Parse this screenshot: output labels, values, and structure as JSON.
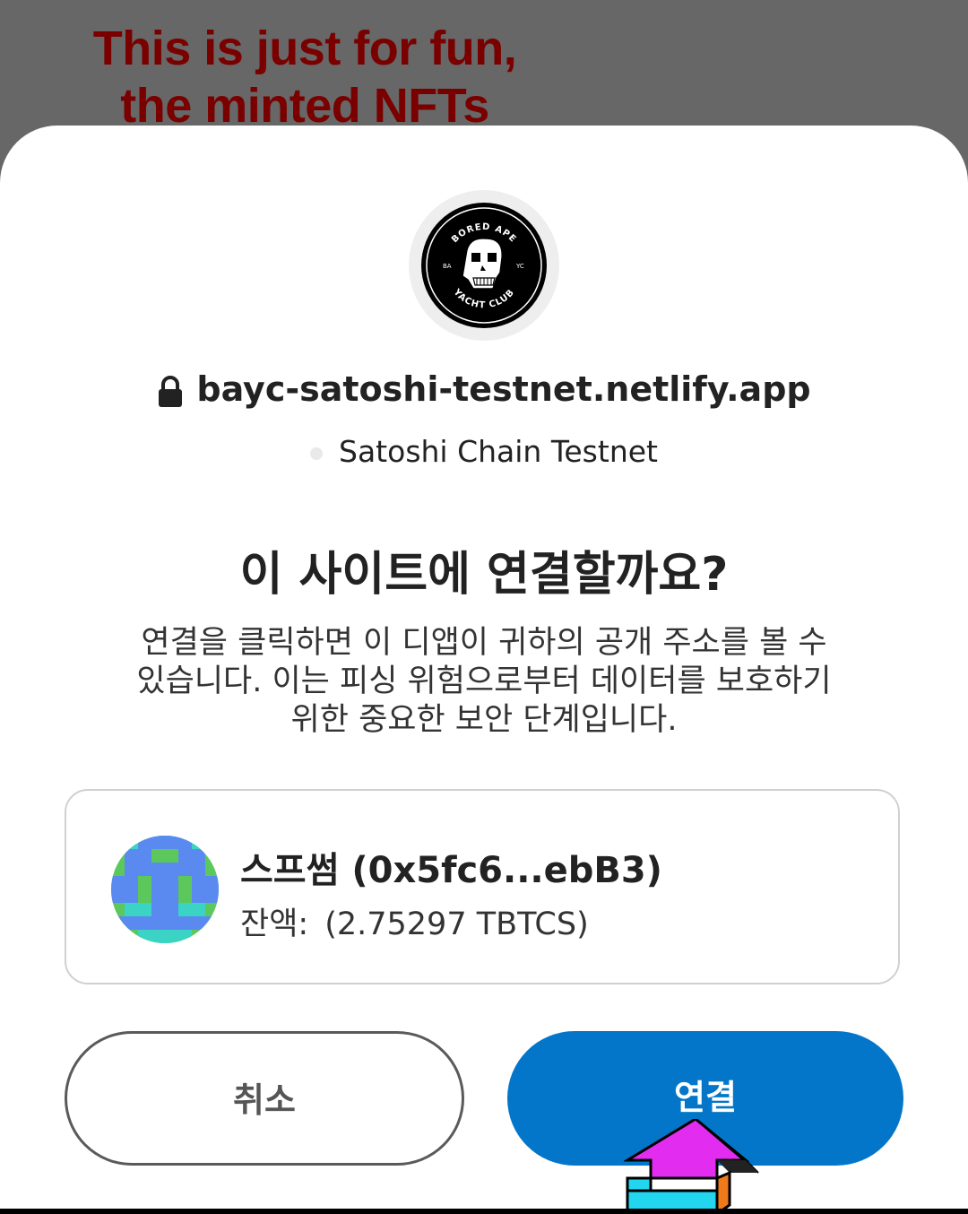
{
  "overlay": {
    "line1": "This is just for fun,",
    "line2": "the minted NFTs"
  },
  "logo": {
    "top_text": "BORED APE",
    "left_text": "BA",
    "right_text": "YC",
    "bottom_text": "YACHT CLUB"
  },
  "site": {
    "domain": "bayc-satoshi-testnet.netlify.app",
    "network": "Satoshi Chain Testnet"
  },
  "dialog": {
    "question": "이 사이트에 연결할까요?",
    "desc_line1": "연결을 클릭하면 이 디앱이 귀하의 공개 주소를 볼 수",
    "desc_line2": "있습니다. 이는 피싱 위험으로부터 데이터를 보호하기",
    "desc_line3": "위한 중요한 보안 단계입니다."
  },
  "account": {
    "name": "스프썸 (0x5fc6...ebB3)",
    "balance_label": "잔액:",
    "balance_value": "(2.75297 TBTCS)"
  },
  "buttons": {
    "cancel": "취소",
    "connect": "연결"
  },
  "colors": {
    "primary": "#0376c9",
    "overlay_text": "#7a0000",
    "backdrop": "#676767"
  }
}
